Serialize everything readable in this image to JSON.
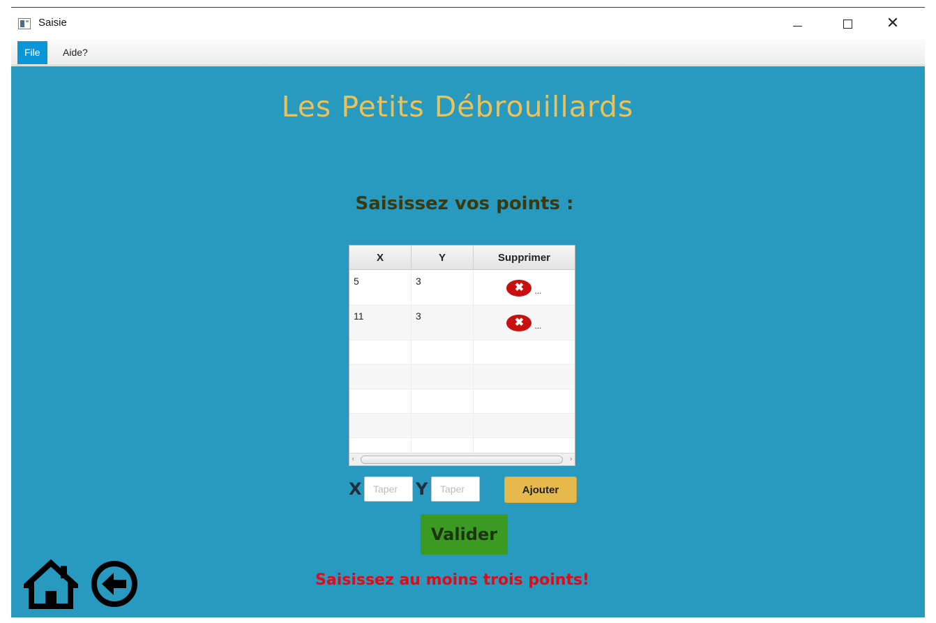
{
  "window": {
    "title": "Saisie",
    "icon": "app-window-icon",
    "controls": [
      "minimize",
      "maximize",
      "close"
    ]
  },
  "menu": {
    "items": [
      {
        "label": "File",
        "selected": true
      },
      {
        "label": "Aide?",
        "selected": false
      }
    ]
  },
  "header": {
    "title": "Les Petits Débrouillards"
  },
  "form": {
    "subtitle": "Saisissez vos points :",
    "table": {
      "columns": [
        "X",
        "Y",
        "Supprimer"
      ],
      "rows": [
        {
          "x": "5",
          "y": "3",
          "action_icon": "delete-icon",
          "action_extra": "..."
        },
        {
          "x": "11",
          "y": "3",
          "action_icon": "delete-icon",
          "action_extra": "..."
        }
      ],
      "empty_rows": 5
    },
    "x_label": "X",
    "x_placeholder": "Taper",
    "y_label": "Y",
    "y_placeholder": "Taper",
    "add_button": "Ajouter",
    "validate_button": "Valider",
    "error_message": "Saisissez au moins trois points!"
  },
  "nav": {
    "home_icon": "home-icon",
    "back_icon": "back-arrow-icon"
  },
  "colors": {
    "background": "#2899bf",
    "title": "#e8c25a",
    "add_button": "#e6b94d",
    "validate_button": "#3a9a22",
    "error": "#e00b16",
    "menu_selected": "#0a96d8",
    "delete_icon": "#c81010"
  }
}
